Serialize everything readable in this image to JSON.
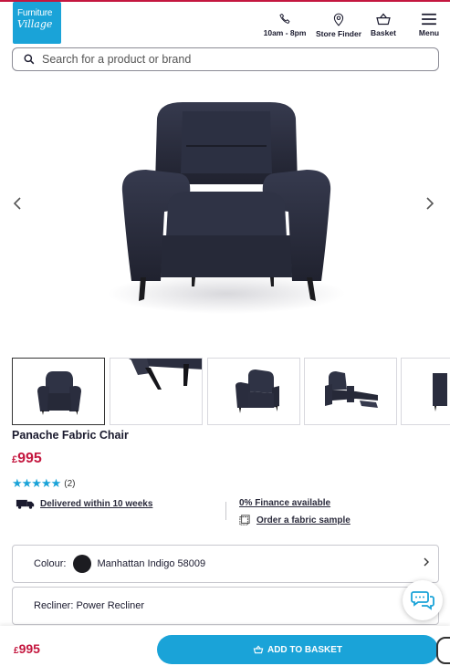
{
  "brand": {
    "line1": "Furniture",
    "line2": "Village",
    "color": "#1aa3d8"
  },
  "header": {
    "phone_label": "10am - 8pm",
    "store_label": "Store Finder",
    "basket_label": "Basket",
    "menu_label": "Menu"
  },
  "search": {
    "placeholder": "Search for a product or brand"
  },
  "product": {
    "name": "Panache Fabric Chair",
    "currency": "£",
    "price": "995",
    "rating_stars": "★★★★★",
    "rating_value": 5,
    "review_count": "(2)",
    "delivery": "Delivered within 10 weeks",
    "finance": "0% Finance available",
    "sample": "Order a fabric sample",
    "accent": "#c4173f"
  },
  "options": {
    "colour_label": "Colour:",
    "colour_value": "Manhattan Indigo 58009",
    "swatch_color": "#1c1c21",
    "recliner_text": "Recliner: Power Recliner"
  },
  "sticky": {
    "currency": "£",
    "price": "995",
    "add_label": "ADD TO BASKET"
  }
}
